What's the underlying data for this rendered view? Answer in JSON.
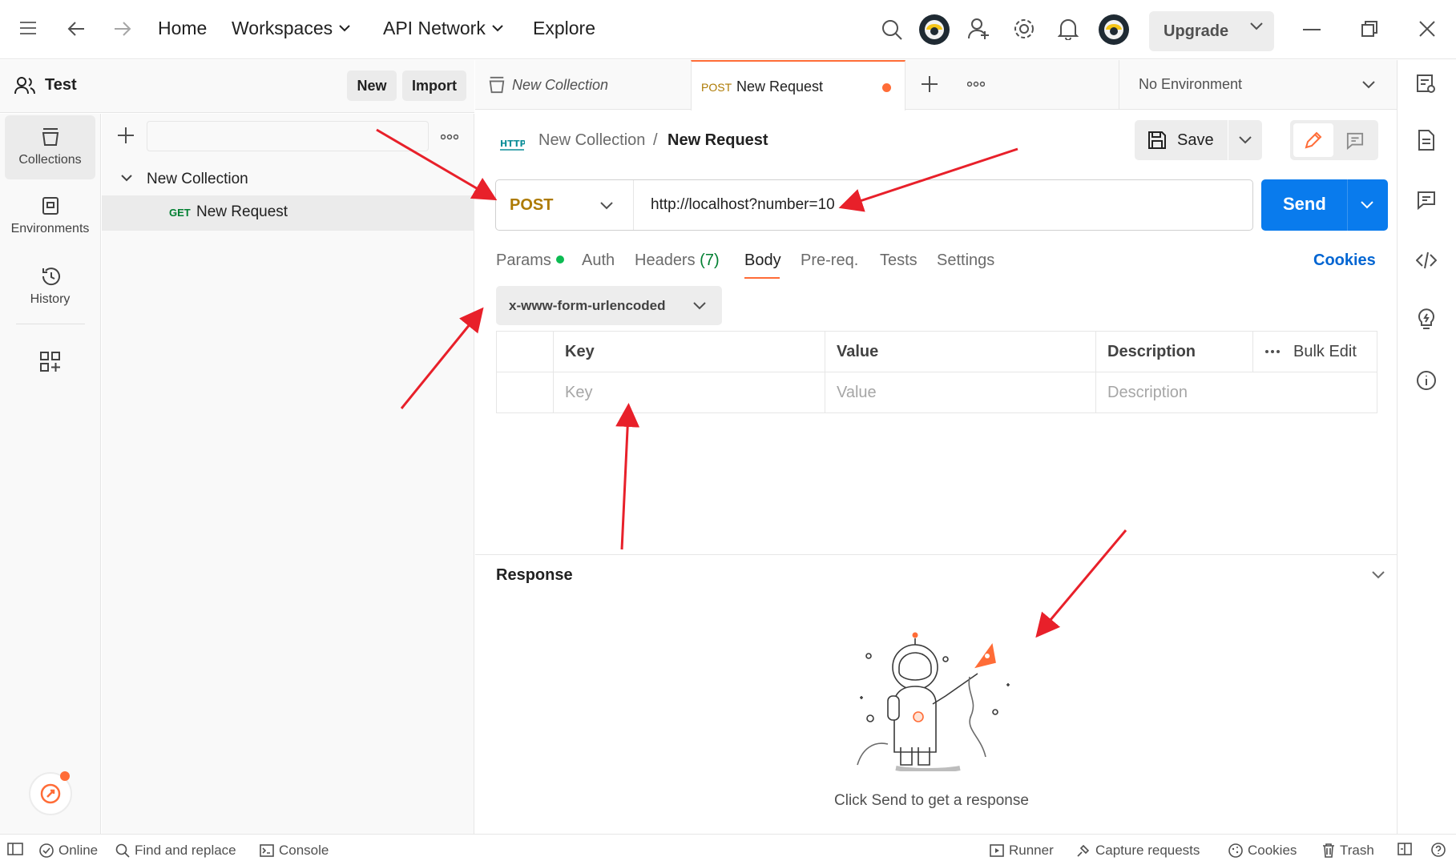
{
  "topbar": {
    "nav": [
      "Home",
      "Workspaces",
      "API Network",
      "Explore"
    ],
    "upgrade_label": "Upgrade"
  },
  "workspace": {
    "name": "Test",
    "new_label": "New",
    "import_label": "Import"
  },
  "rail": {
    "items": [
      "Collections",
      "Environments",
      "History"
    ]
  },
  "sidebar": {
    "collection_name": "New Collection",
    "request_method": "GET",
    "request_name": "New Request"
  },
  "tabs": {
    "collection_tab": "New Collection",
    "request_tab_method": "POST",
    "request_tab_name": "New Request",
    "environment": "No Environment"
  },
  "breadcrumb": {
    "collection": "New Collection",
    "separator": "/",
    "request": "New Request",
    "save_label": "Save"
  },
  "request": {
    "method": "POST",
    "url": "http://localhost?number=10",
    "send_label": "Send",
    "tabs": {
      "params": "Params",
      "auth": "Auth",
      "headers": "Headers",
      "headers_count": "(7)",
      "body": "Body",
      "prereq": "Pre-req.",
      "tests": "Tests",
      "settings": "Settings"
    },
    "cookies_label": "Cookies",
    "body_type": "x-www-form-urlencoded"
  },
  "table": {
    "headers": [
      "Key",
      "Value",
      "Description"
    ],
    "bulk_edit": "Bulk Edit",
    "placeholders": [
      "Key",
      "Value",
      "Description"
    ]
  },
  "response": {
    "title": "Response",
    "empty_message": "Click Send to get a response"
  },
  "statusbar": {
    "online": "Online",
    "find_replace": "Find and replace",
    "console": "Console",
    "runner": "Runner",
    "capture": "Capture requests",
    "cookies": "Cookies",
    "trash": "Trash"
  },
  "colors": {
    "accent": "#ff6c37",
    "send": "#097bed",
    "post": "#ad7a03",
    "get": "#007f31",
    "link": "#0265d2",
    "annotation": "#e8202a"
  }
}
